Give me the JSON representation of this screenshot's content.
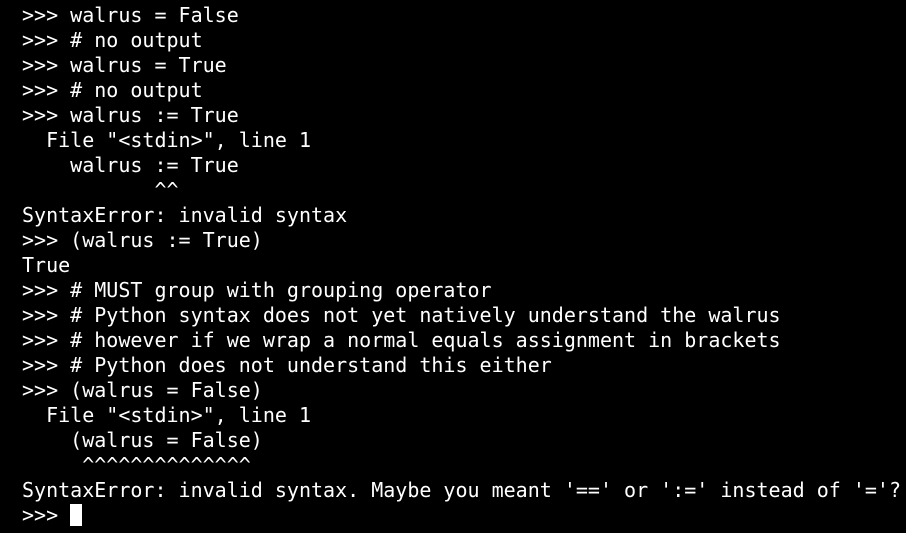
{
  "terminal": {
    "colors": {
      "background": "#000000",
      "foreground": "#ffffff"
    },
    "lines": [
      ">>> walrus = False",
      ">>> # no output",
      ">>> walrus = True",
      ">>> # no output",
      ">>> walrus := True",
      "  File \"<stdin>\", line 1",
      "    walrus := True",
      "           ^^",
      "SyntaxError: invalid syntax",
      ">>> (walrus := True)",
      "True",
      ">>> # MUST group with grouping operator",
      ">>> # Python syntax does not yet natively understand the walrus",
      ">>> # however if we wrap a normal equals assignment in brackets",
      ">>> # Python does not understand this either",
      ">>> (walrus = False)",
      "  File \"<stdin>\", line 1",
      "    (walrus = False)",
      "     ^^^^^^^^^^^^^^",
      "SyntaxError: invalid syntax. Maybe you meant '==' or ':=' instead of '='?"
    ],
    "prompt": ">>> "
  }
}
